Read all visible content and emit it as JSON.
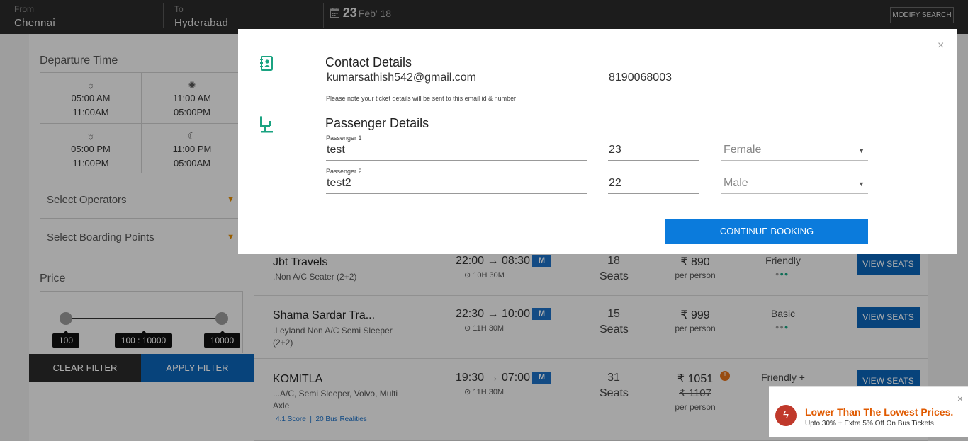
{
  "topbar": {
    "from_label": "From",
    "from_value": "Chennai",
    "to_label": "To",
    "to_value": "Hyderabad",
    "date_day": "23",
    "date_rest": "Feb' 18",
    "modify_label": "MODIFY SEARCH",
    "calendar_icon": "calendar-icon"
  },
  "sidebar": {
    "departure_title": "Departure Time",
    "slots": [
      {
        "icon": "sun-icon",
        "start": "05:00 AM",
        "end": "11:00AM"
      },
      {
        "icon": "bright-sun-icon",
        "start": "11:00 AM",
        "end": "05:00PM"
      },
      {
        "icon": "sunset-icon",
        "start": "05:00 PM",
        "end": "11:00PM"
      },
      {
        "icon": "moon-icon",
        "start": "11:00 PM",
        "end": "05:00AM"
      }
    ],
    "operators_label": "Select Operators",
    "boarding_label": "Select Boarding Points",
    "price_title": "Price",
    "price_min": "100",
    "price_range": "100 : 10000",
    "price_max": "10000",
    "price_range_min_value": 100,
    "price_range_max_value": 10000,
    "clear_label": "CLEAR FILTER",
    "apply_label": "APPLY FILTER"
  },
  "buses": [
    {
      "name": "Jbt Travels",
      "type": ".Non A/C Seater (2+2)",
      "depart": "22:00",
      "arrive": "08:30",
      "duration": "10H 30M",
      "seats_count": "18",
      "seats_word": "Seats",
      "price": "₹ 890",
      "per_person": "per person",
      "rating": "Friendly",
      "view_label": "VIEW SEATS"
    },
    {
      "name": "Shama Sardar Tra...",
      "type": ".Leyland Non A/C Semi Sleeper (2+2)",
      "depart": "22:30",
      "arrive": "10:00",
      "duration": "11H 30M",
      "seats_count": "15",
      "seats_word": "Seats",
      "price": "₹ 999",
      "per_person": "per person",
      "rating": "Basic",
      "view_label": "VIEW SEATS"
    },
    {
      "name": "KOMITLA",
      "type": "...A/C, Semi Sleeper, Volvo, Multi Axle",
      "depart": "19:30",
      "arrive": "07:00",
      "duration": "11H 30M",
      "seats_count": "31",
      "seats_word": "Seats",
      "price": "₹ 1051",
      "old_price": "₹ 1107",
      "per_person": "per person",
      "rating": "Friendly +",
      "score": "4.1 Score",
      "realities": "20 Bus Realities",
      "view_label": "VIEW SEATS"
    }
  ],
  "toast": {
    "title": "Lower Than The Lowest Prices.",
    "subtitle": "Upto 30% + Extra 5% Off On Bus Tickets",
    "icon": "lightning-icon",
    "close": "×"
  },
  "modal": {
    "close": "×",
    "contact_title": "Contact Details",
    "email": "kumarsathish542@gmail.com",
    "phone": "8190068003",
    "note": "Please note your ticket details will be sent to this email id & number",
    "passenger_title": "Passenger Details",
    "passengers": [
      {
        "label": "Passenger 1",
        "name": "test",
        "age": "23",
        "gender": "Female"
      },
      {
        "label": "Passenger 2",
        "name": "test2",
        "age": "22",
        "gender": "Male"
      }
    ],
    "continue_label": "CONTINUE BOOKING"
  },
  "colors": {
    "accent_blue": "#0b63b6",
    "button_blue": "#0b7bdc",
    "icon_green": "#1aa381",
    "warning_orange": "#e05a00"
  }
}
